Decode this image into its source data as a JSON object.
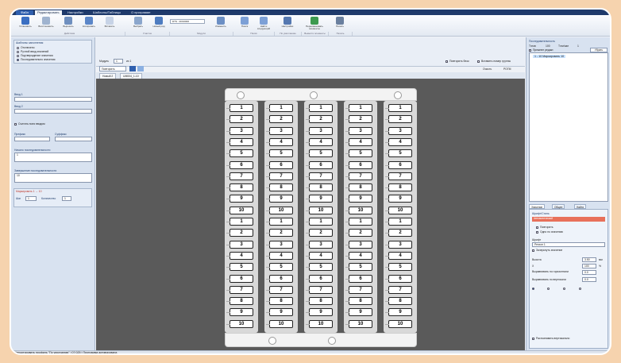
{
  "ribbon": {
    "tabs": [
      "Файл",
      "Редактировать",
      "Настройки",
      "Шаблоны/Таблицы",
      "О программе"
    ],
    "buttons": [
      "Установить",
      "Восстановить",
      "Вырезать",
      "Копировать",
      "Вставить",
      "Выбрать",
      "Новый ряд",
      "Вид",
      "Изменить",
      "Поиск",
      "Найти следующий",
      "Настройки",
      "Переименовать элементы",
      "Печать"
    ],
    "combo": "DTS : 40/10000",
    "groups": [
      "Действия",
      "Участок",
      "Модули",
      "Поиск",
      "По умолчанию",
      "Вывести элементы",
      "Печать"
    ]
  },
  "left": {
    "group_title": "Шаблоны заполнения",
    "radios": [
      "Отключено",
      "Ручной ввод значений",
      "Подтверждение значения",
      "Последовательно значения"
    ],
    "radio_selected": 3,
    "field1_label": "Ввод 1",
    "field2_label": "Ввод 2",
    "checkbox_label": "Считать поля вводом",
    "prefix_label": "Префикс",
    "suffix_label": "Суффикс",
    "start_label": "Начало последовательности",
    "start_value": "1",
    "end_label": "Завершение последовательности",
    "end_value": "10",
    "repeat_title": "Маркировать 1 → 10",
    "step_label": "Шаг",
    "step_value": "1",
    "count_label": "Количество",
    "count_value": "1"
  },
  "toolstrip": {
    "module_label": "Модуль",
    "module_value": "1",
    "of_label": "из 1",
    "apply_button": "Повторить",
    "chk_repeat": "Повторить блок",
    "chk_insert": "Вставить номер группы",
    "right_label1": "Очисть",
    "right_label2": "РОГМ"
  },
  "doc_tabs": [
    "Новый 2",
    "UM004_1-10"
  ],
  "markers": [
    "1",
    "2",
    "3",
    "4",
    "5",
    "6",
    "7",
    "8",
    "9",
    "10",
    "1",
    "2",
    "3",
    "4",
    "5",
    "6",
    "7",
    "8",
    "9",
    "10"
  ],
  "right": {
    "title": "Последовательность",
    "row_labels": [
      "Тэгов",
      "Тэги/зап"
    ],
    "row_values": [
      "100",
      "1"
    ],
    "chk_prev": "Прежнее редакт.",
    "btn_clear": "Убрать",
    "tree_item": "1 - 10 Маркировать 10",
    "tabs": [
      "Значение",
      "Общее",
      "Найти"
    ],
    "section_title": "Шрифт/Стиль",
    "format_combo": "Автоматический",
    "chk_repeat": "Повторить",
    "chk_same": "Одно по значению",
    "font_label": "Шрифт",
    "font_value": "Регион 1",
    "chk_underline": "Зачеркнуть значение",
    "size_label": "Высота",
    "size_value": "3.50",
    "unit": "мм",
    "width_label": "X",
    "width_value": "100",
    "unit_pct": "%",
    "h_label": "Выравнивать по горизонтали",
    "h_value": "0.0",
    "v_label": "Выравнивать по вертикали",
    "v_value": "0.0",
    "chk_vertical": "Распознавать вертикально"
  },
  "status": "Импортировать профиль \"По умолчанию\" | 07:025 | Программа активирована"
}
